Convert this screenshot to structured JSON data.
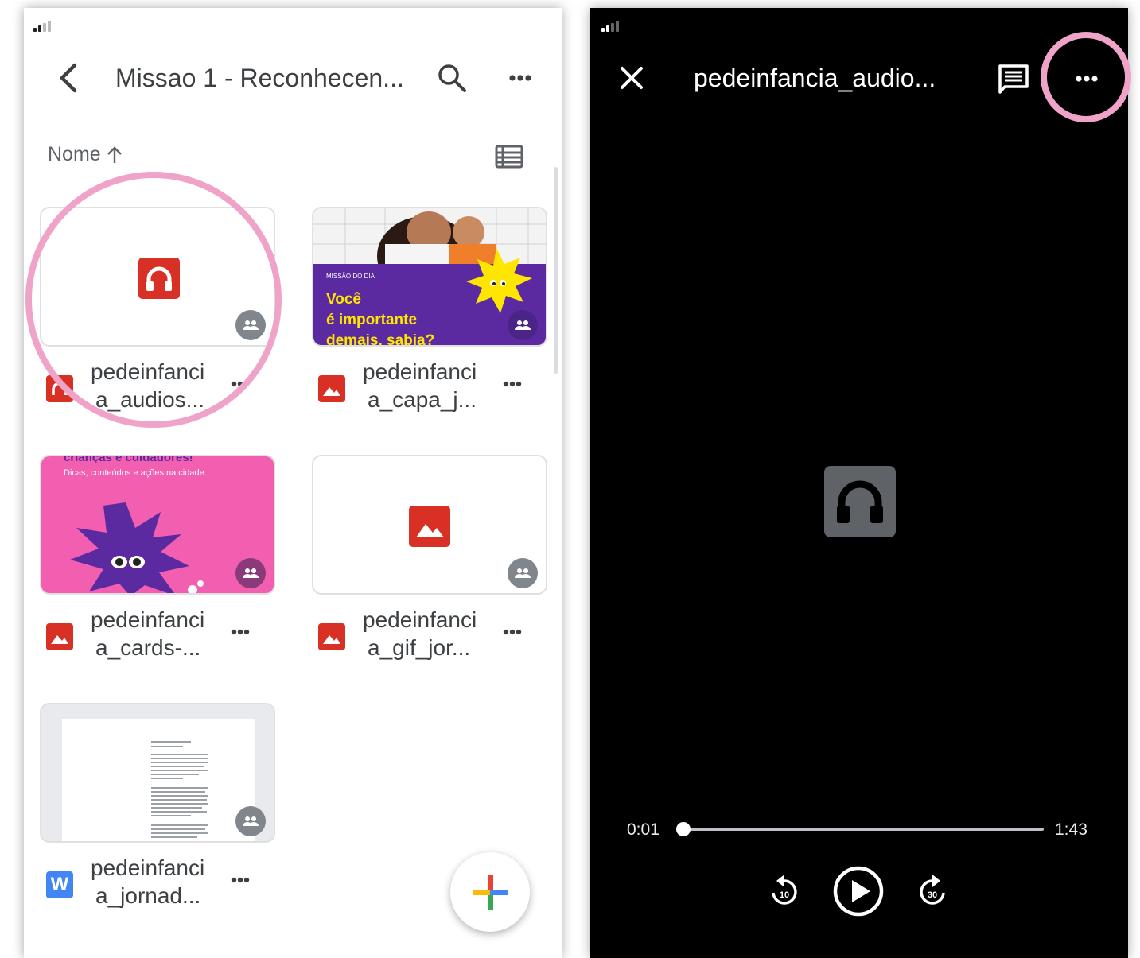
{
  "left_screen": {
    "header": {
      "back_label": "back",
      "title": "Missao 1 - Reconhecen...",
      "search_icon": "search-icon",
      "more_icon": "more-horizontal-icon"
    },
    "sort": {
      "label": "Nome",
      "direction_icon": "arrow-up-icon"
    },
    "view_toggle_icon": "list-view-icon",
    "files": [
      {
        "name_line1": "pedeinfanci",
        "name_line2": "a_audios...",
        "type": "audio",
        "thumbnail": "audio-icon",
        "shared": true
      },
      {
        "name_line1": "pedeinfanci",
        "name_line2": "a_capa_j...",
        "type": "image",
        "thumbnail": "photo",
        "thumb_text": {
          "tag": "MISSÃO DO DIA",
          "line1": "Você",
          "line2": "é importante",
          "line3": "demais, sabia?"
        },
        "shared": true
      },
      {
        "name_line1": "pedeinfanci",
        "name_line2": "a_cards-...",
        "type": "image",
        "thumbnail": "pink-card",
        "thumb_text": {
          "headline": "crianças e cuidadores!",
          "sub": "Dicas, conteúdos e ações na cidade."
        },
        "shared": true
      },
      {
        "name_line1": "pedeinfanci",
        "name_line2": "a_gif_jor...",
        "type": "image",
        "thumbnail": "image-icon",
        "shared": true
      },
      {
        "name_line1": "pedeinfanci",
        "name_line2": "a_jornad...",
        "type": "word",
        "thumbnail": "document",
        "shared": true,
        "word_letter": "W"
      }
    ],
    "fab_icon": "plus-icon"
  },
  "right_screen": {
    "header": {
      "close_icon": "close-icon",
      "title": "pedeinfancia_audio...",
      "comment_icon": "comment-icon",
      "more_icon": "more-horizontal-icon"
    },
    "player": {
      "current_time": "0:01",
      "total_time": "1:43",
      "progress_fraction": 0.01,
      "rewind_label": "10",
      "forward_label": "30"
    }
  },
  "colors": {
    "accent_pink": "#f0a3c8",
    "drive_red": "#d93025",
    "word_blue": "#4285f4",
    "purple": "#5b2aa0",
    "yellow": "#ffe600",
    "card_pink": "#f25eb0"
  }
}
